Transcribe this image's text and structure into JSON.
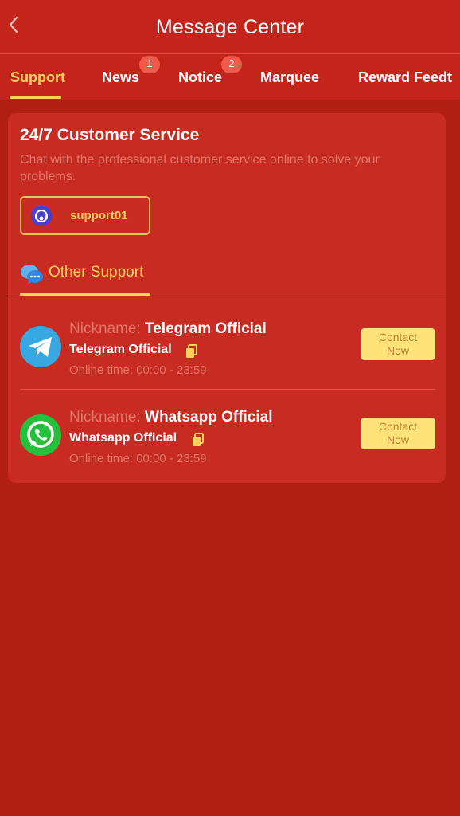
{
  "header": {
    "title": "Message Center",
    "back_icon": "chevron-left-icon"
  },
  "tabs": [
    {
      "label": "Support",
      "active": true,
      "badge": ""
    },
    {
      "label": "News",
      "active": false,
      "badge": "1"
    },
    {
      "label": "Notice",
      "active": false,
      "badge": "2"
    },
    {
      "label": "Marquee",
      "active": false,
      "badge": ""
    },
    {
      "label": "Reward Feedt",
      "active": false,
      "badge": ""
    }
  ],
  "customer_service": {
    "title": "24/7 Customer Service",
    "description": "Chat with the professional customer service online to solve your problems.",
    "support_button": "support01"
  },
  "other_support": {
    "label": "Other Support",
    "contacts": [
      {
        "nickname_label": "Nickname:",
        "nickname": "Telegram Official",
        "name": "Telegram Official",
        "online_time": "Online time: 00:00 - 23:59",
        "contact_line1": "Contact",
        "contact_line2": "Now",
        "icon": "telegram-icon"
      },
      {
        "nickname_label": "Nickname:",
        "nickname": "Whatsapp Official",
        "name": "Whatsapp Official",
        "online_time": "Online time: 00:00 - 23:59",
        "contact_line1": "Contact",
        "contact_line2": "Now",
        "icon": "whatsapp-icon"
      }
    ]
  },
  "colors": {
    "background": "#b01f12",
    "header": "#c4241a",
    "card": "#c72b22",
    "accent": "#ffd35b",
    "muted_text": "#e0776b",
    "contact_button": "#ffe37a"
  }
}
